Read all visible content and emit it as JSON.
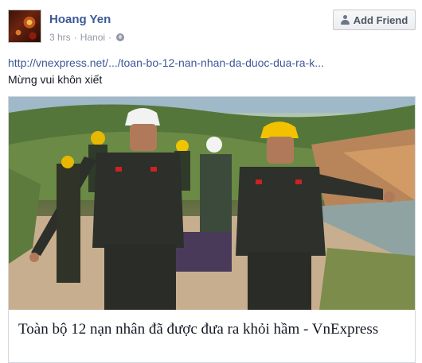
{
  "post": {
    "author": "Hoang Yen",
    "time": "3 hrs",
    "location": "Hanoi",
    "separator": "·",
    "add_friend_label": "Add Friend",
    "link_text": "http://vnexpress.net/.../toan-bo-12-nan-nhan-da-duoc-dua-ra-k...",
    "status_text": "Mừng vui khôn xiết",
    "icons": {
      "add_friend": "person-add-icon",
      "audience": "globe-icon"
    }
  },
  "attachment": {
    "title": "Toàn bộ 12 nạn nhân đã được đưa ra khỏi hầm - VnExpress"
  },
  "colors": {
    "link": "#3b5998",
    "meta": "#9197a3",
    "text": "#141823"
  }
}
